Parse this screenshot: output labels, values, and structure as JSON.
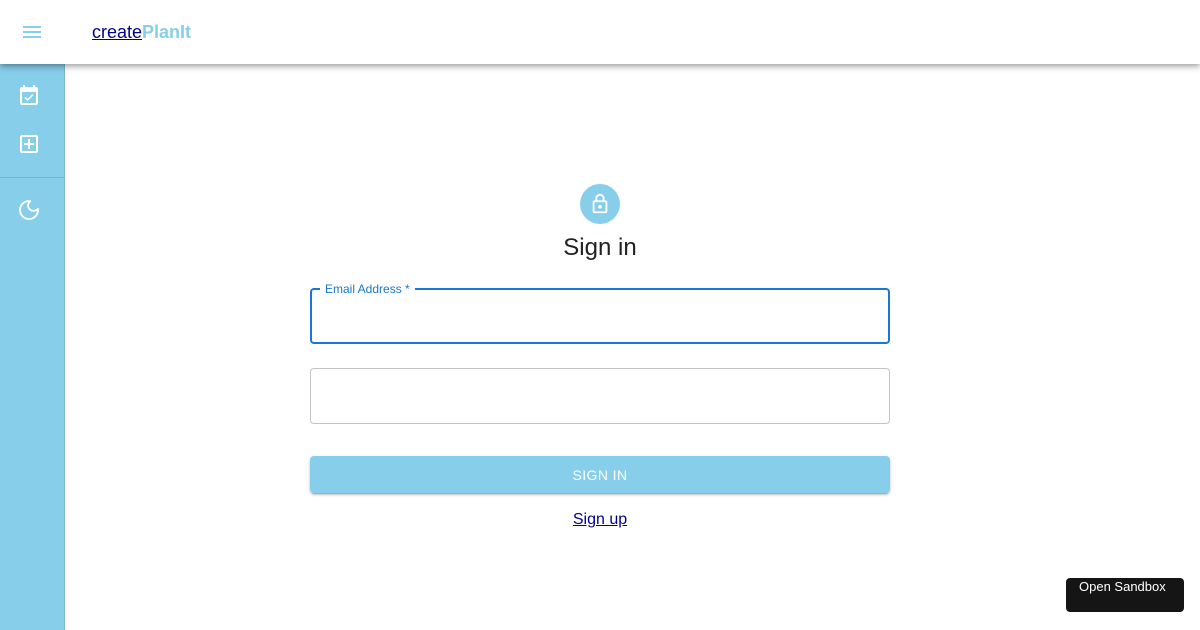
{
  "brand": {
    "part1": "create",
    "part2": "PlanIt"
  },
  "sidebar": {
    "items": [
      {
        "name": "calendar",
        "icon": "event-available-icon"
      },
      {
        "name": "add",
        "icon": "add-box-icon"
      },
      {
        "name": "dark-mode",
        "icon": "moon-icon"
      }
    ]
  },
  "form": {
    "title": "Sign in",
    "email": {
      "label": "Email Address *",
      "value": ""
    },
    "password": {
      "value": ""
    },
    "submit_label": "Sign In",
    "signup_link": "Sign up"
  },
  "sandbox_button": "Open Sandbox",
  "colors": {
    "accent": "#87ceeb",
    "focus": "#1976d2",
    "link": "#00008b"
  }
}
